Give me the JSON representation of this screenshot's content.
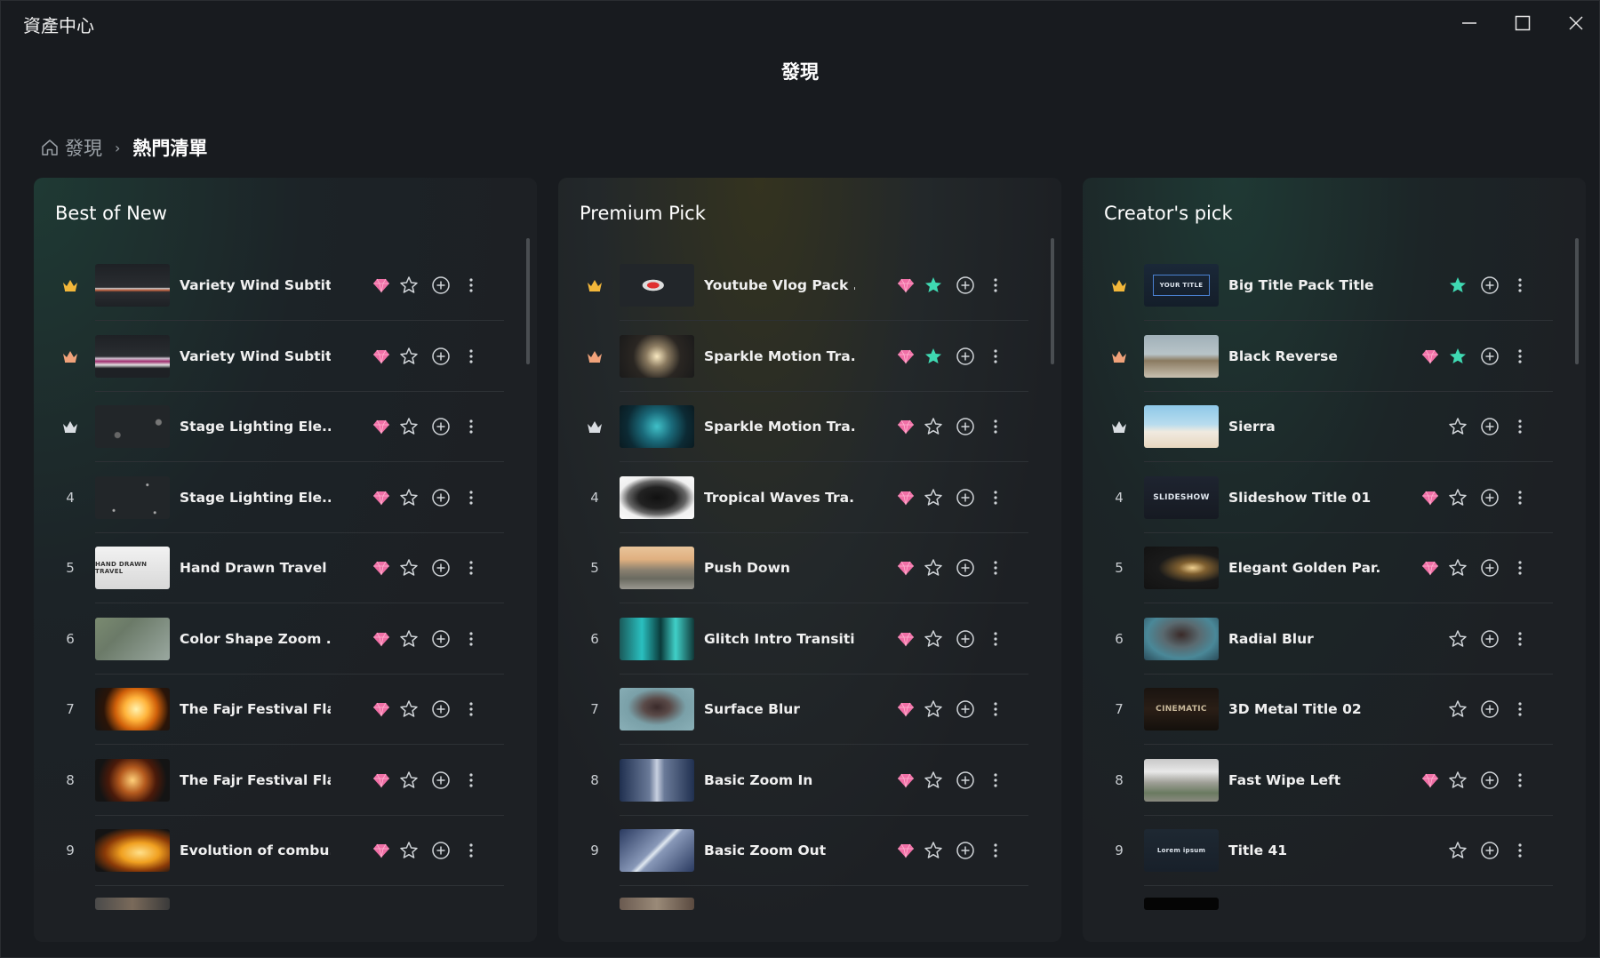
{
  "app": {
    "title": "資產中心"
  },
  "page": {
    "title": "發現"
  },
  "breadcrumb": {
    "home": "發現",
    "separator": "›",
    "current": "熱門清單"
  },
  "colors": {
    "accent_teal": "#3fd9b2",
    "gem_pink": "#f06fa6",
    "crown_gold": "#f3b73a",
    "crown_bronze": "#f0a27a",
    "crown_silver": "#d9dde2"
  },
  "panels": [
    {
      "title": "Best of New",
      "items": [
        {
          "rank": "",
          "crown": "gold",
          "name": "Variety Wind Subtit...",
          "premium": true,
          "favorite": false,
          "thumb": "wind1"
        },
        {
          "rank": "",
          "crown": "bronze",
          "name": "Variety Wind Subtit...",
          "premium": true,
          "favorite": false,
          "thumb": "wind2"
        },
        {
          "rank": "",
          "crown": "silver",
          "name": "Stage Lighting Ele...",
          "premium": true,
          "favorite": false,
          "thumb": "stage1"
        },
        {
          "rank": "4",
          "crown": "",
          "name": "Stage Lighting Ele...",
          "premium": true,
          "favorite": false,
          "thumb": "stage2"
        },
        {
          "rank": "5",
          "crown": "",
          "name": "Hand Drawn Travel ...",
          "premium": true,
          "favorite": false,
          "thumb": "travel",
          "thumb_text": "HAND DRAWN TRAVEL"
        },
        {
          "rank": "6",
          "crown": "",
          "name": "Color Shape Zoom ...",
          "premium": true,
          "favorite": false,
          "thumb": "shape"
        },
        {
          "rank": "7",
          "crown": "",
          "name": "The Fajr Festival Fla...",
          "premium": true,
          "favorite": false,
          "thumb": "fire1"
        },
        {
          "rank": "8",
          "crown": "",
          "name": "The Fajr Festival Fla...",
          "premium": true,
          "favorite": false,
          "thumb": "fire2"
        },
        {
          "rank": "9",
          "crown": "",
          "name": "Evolution of combu...",
          "premium": true,
          "favorite": false,
          "thumb": "fire3"
        },
        {
          "rank": "",
          "crown": "",
          "name": "",
          "premium": false,
          "favorite": false,
          "thumb": "partial1",
          "partial": true
        }
      ]
    },
    {
      "title": "Premium Pick",
      "items": [
        {
          "rank": "",
          "crown": "gold",
          "name": "Youtube Vlog Pack ...",
          "premium": true,
          "favorite": true,
          "thumb": "vlog"
        },
        {
          "rank": "",
          "crown": "bronze",
          "name": "Sparkle Motion Tra...",
          "premium": true,
          "favorite": true,
          "thumb": "sparkle1"
        },
        {
          "rank": "",
          "crown": "silver",
          "name": "Sparkle Motion Tra...",
          "premium": true,
          "favorite": false,
          "thumb": "sparkle2"
        },
        {
          "rank": "4",
          "crown": "",
          "name": "Tropical Waves Tra...",
          "premium": true,
          "favorite": false,
          "thumb": "ink"
        },
        {
          "rank": "5",
          "crown": "",
          "name": "Push Down",
          "premium": true,
          "favorite": false,
          "thumb": "push"
        },
        {
          "rank": "6",
          "crown": "",
          "name": "Glitch Intro Transiti...",
          "premium": true,
          "favorite": false,
          "thumb": "glitch"
        },
        {
          "rank": "7",
          "crown": "",
          "name": "Surface Blur",
          "premium": true,
          "favorite": false,
          "thumb": "surface"
        },
        {
          "rank": "8",
          "crown": "",
          "name": "Basic Zoom In",
          "premium": true,
          "favorite": false,
          "thumb": "zoomin"
        },
        {
          "rank": "9",
          "crown": "",
          "name": "Basic Zoom Out",
          "premium": true,
          "favorite": false,
          "thumb": "zoomout"
        },
        {
          "rank": "",
          "crown": "",
          "name": "",
          "premium": false,
          "favorite": false,
          "thumb": "partial2",
          "partial": true
        }
      ]
    },
    {
      "title": "Creator's pick",
      "items": [
        {
          "rank": "",
          "crown": "gold",
          "name": "Big Title Pack Title ...",
          "premium": false,
          "favorite": true,
          "thumb": "yourtitle",
          "thumb_text": "YOUR TITLE"
        },
        {
          "rank": "",
          "crown": "bronze",
          "name": "Black Reverse",
          "premium": true,
          "favorite": true,
          "thumb": "reverse"
        },
        {
          "rank": "",
          "crown": "silver",
          "name": "Sierra",
          "premium": false,
          "favorite": false,
          "thumb": "sierra"
        },
        {
          "rank": "4",
          "crown": "",
          "name": "Slideshow Title 01",
          "premium": true,
          "favorite": false,
          "thumb": "slideshow",
          "thumb_text": "SLIDESHOW"
        },
        {
          "rank": "5",
          "crown": "",
          "name": "Elegant Golden Par...",
          "premium": true,
          "favorite": false,
          "thumb": "golden"
        },
        {
          "rank": "6",
          "crown": "",
          "name": "Radial Blur",
          "premium": false,
          "favorite": false,
          "thumb": "radial"
        },
        {
          "rank": "7",
          "crown": "",
          "name": "3D Metal Title 02",
          "premium": false,
          "favorite": false,
          "thumb": "metal",
          "thumb_text": "CINEMATIC"
        },
        {
          "rank": "8",
          "crown": "",
          "name": "Fast Wipe Left",
          "premium": true,
          "favorite": false,
          "thumb": "wipe"
        },
        {
          "rank": "9",
          "crown": "",
          "name": "Title 41",
          "premium": false,
          "favorite": false,
          "thumb": "title41",
          "thumb_text": "Lorem ipsum"
        },
        {
          "rank": "",
          "crown": "",
          "name": "",
          "premium": false,
          "favorite": false,
          "thumb": "partial3",
          "partial": true
        }
      ]
    }
  ]
}
